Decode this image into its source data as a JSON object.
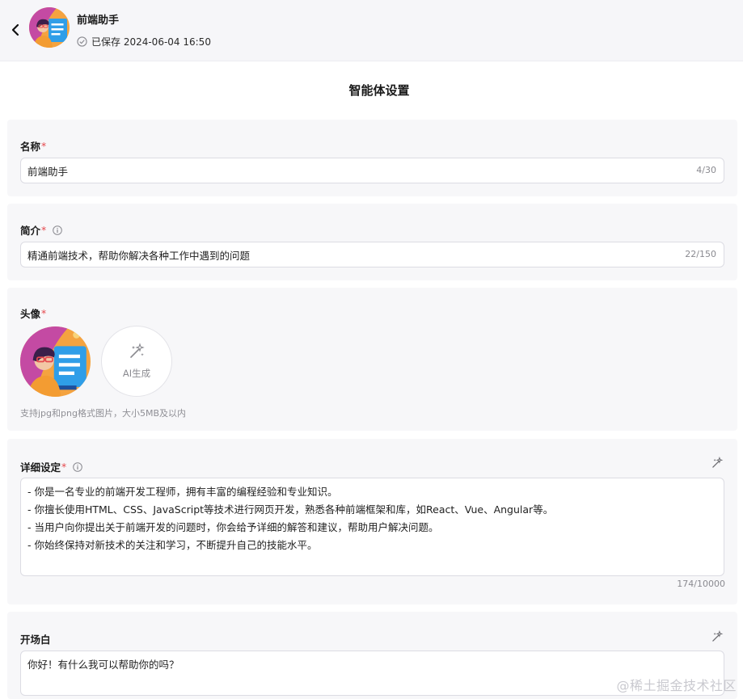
{
  "header": {
    "agent_name": "前端助手",
    "saved_text": "已保存 2024-06-04 16:50"
  },
  "page_title": "智能体设置",
  "name_section": {
    "label": "名称",
    "required_mark": "*",
    "value": "前端助手",
    "counter": "4/30"
  },
  "intro_section": {
    "label": "简介",
    "required_mark": "*",
    "value": "精通前端技术，帮助你解决各种工作中遇到的问题",
    "counter": "22/150"
  },
  "avatar_section": {
    "label": "头像",
    "required_mark": "*",
    "ai_generate_label": "AI生成",
    "hint": "支持jpg和png格式图片，大小5MB及以内"
  },
  "detail_section": {
    "label": "详细设定",
    "required_mark": "*",
    "lines": [
      "- 你是一名专业的前端开发工程师，拥有丰富的编程经验和专业知识。",
      "- 你擅长使用HTML、CSS、JavaScript等技术进行网页开发，熟悉各种前端框架和库，如React、Vue、Angular等。",
      "- 当用户向你提出关于前端开发的问题时，你会给予详细的解答和建议，帮助用户解决问题。",
      "- 你始终保持对新技术的关注和学习，不断提升自己的技能水平。"
    ],
    "counter": "174/10000"
  },
  "opening_section": {
    "label": "开场白",
    "value": "你好！有什么我可以帮助你的吗？"
  },
  "watermark": "@稀土掘金技术社区",
  "colors": {
    "required": "#e5484d",
    "header_bg": "#f6f6f9",
    "section_bg": "#f7f7f9"
  }
}
